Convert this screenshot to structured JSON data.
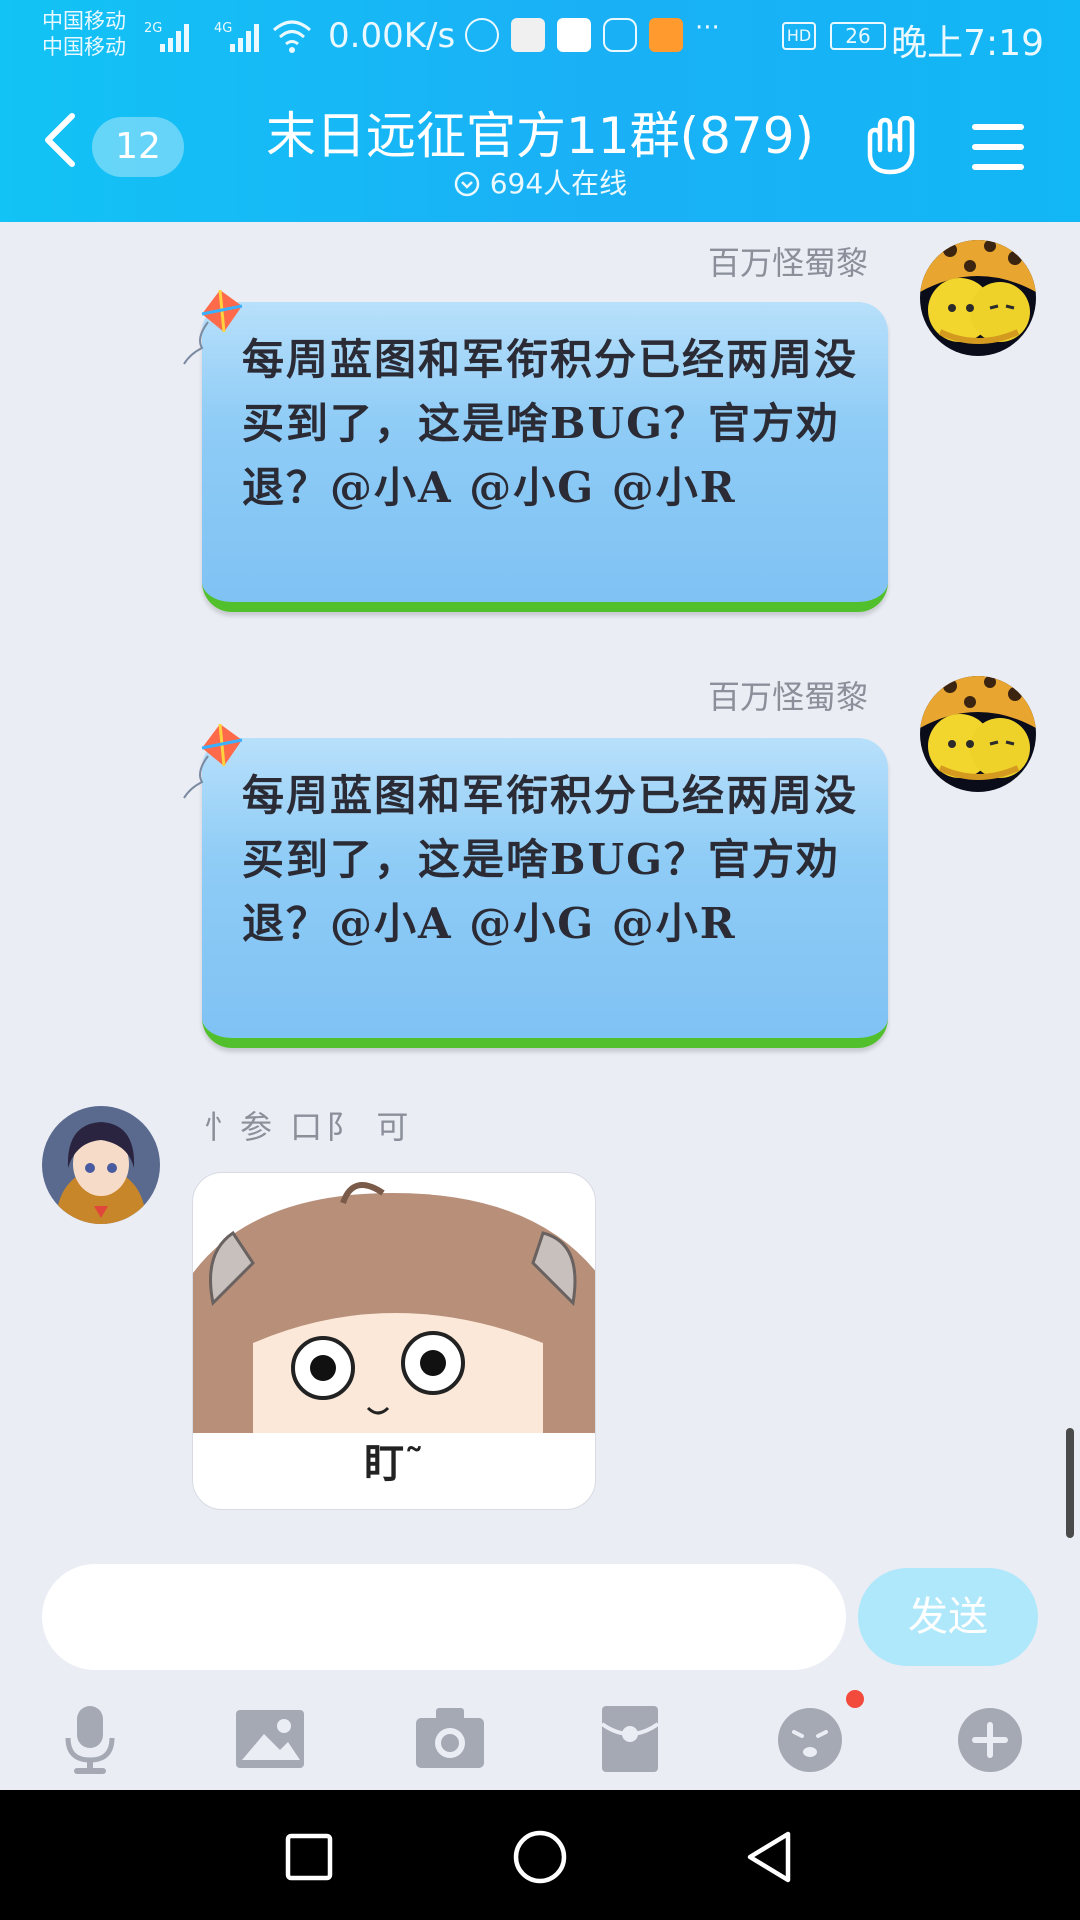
{
  "status_bar": {
    "carrier_1": "中国移动",
    "carrier_2": "中国移动",
    "net_1": "2G",
    "net_2": "4G",
    "speed": "0.00K/s",
    "hd": "HD",
    "battery": "26",
    "time": "晚上7:19"
  },
  "header": {
    "unread_badge": "12",
    "title": "末日远征官方11群(879)",
    "online": "694人在线"
  },
  "messages": [
    {
      "sender": "百万怪蜀黎",
      "text": "每周蓝图和军衔积分已经两周没买到了，这是啥BUG？官方劝退？@小A @小G @小R"
    },
    {
      "sender": "百万怪蜀黎",
      "text": "每周蓝图和军衔积分已经两周没买到了，这是啥BUG？官方劝退？@小A @小G @小R"
    },
    {
      "sender": "忄参 口阝 可",
      "sticker_caption": "盯˜"
    }
  ],
  "input": {
    "placeholder": "",
    "send_label": "发送"
  },
  "colors": {
    "header": "#12b7f5",
    "bubble_blue": "#8fccf6",
    "grass": "#52c02c",
    "send_button": "#b0e8fb",
    "badge_red": "#f24a3b"
  },
  "icons": [
    "back-arrow-icon",
    "hand-gesture-icon",
    "menu-icon",
    "microphone-icon",
    "image-icon",
    "camera-icon",
    "red-packet-icon",
    "emoji-icon",
    "plus-icon",
    "nav-recent-icon",
    "nav-home-icon",
    "nav-back-icon"
  ]
}
